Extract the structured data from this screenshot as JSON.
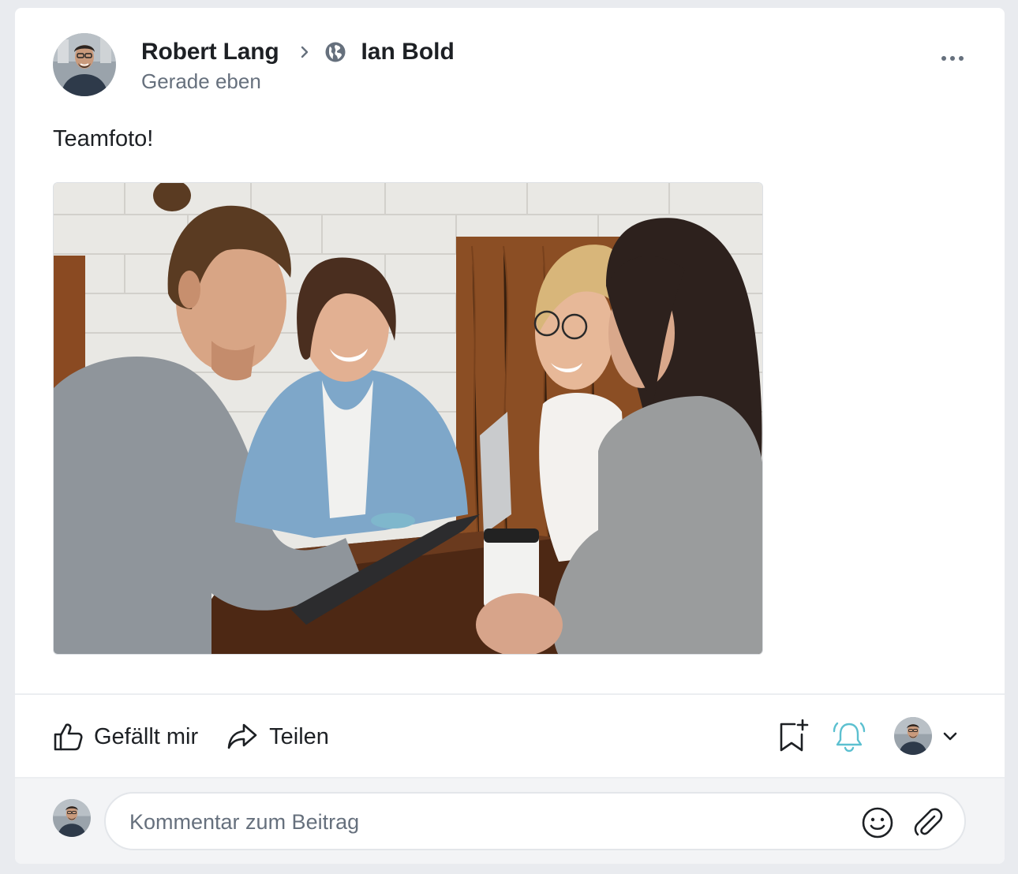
{
  "post": {
    "author": "Robert Lang",
    "target": "Ian Bold",
    "timestamp": "Gerade eben",
    "text": "Teamfoto!"
  },
  "actions": {
    "like_label": "Gefällt mir",
    "share_label": "Teilen"
  },
  "comment": {
    "placeholder": "Kommentar zum Beitrag"
  },
  "icons": {
    "header": [
      "chevron-right-icon",
      "globe-icon",
      "more-icon"
    ],
    "actions": [
      "thumbs-up-icon",
      "share-arrow-icon",
      "bookmark-plus-icon",
      "bell-icon",
      "chevron-down-icon"
    ],
    "comment": [
      "smiley-icon",
      "paperclip-icon"
    ]
  },
  "colors": {
    "text": "#1d2024",
    "muted": "#66707d",
    "bell_accent": "#5cc0d0",
    "page_bg": "#e9ebef"
  }
}
